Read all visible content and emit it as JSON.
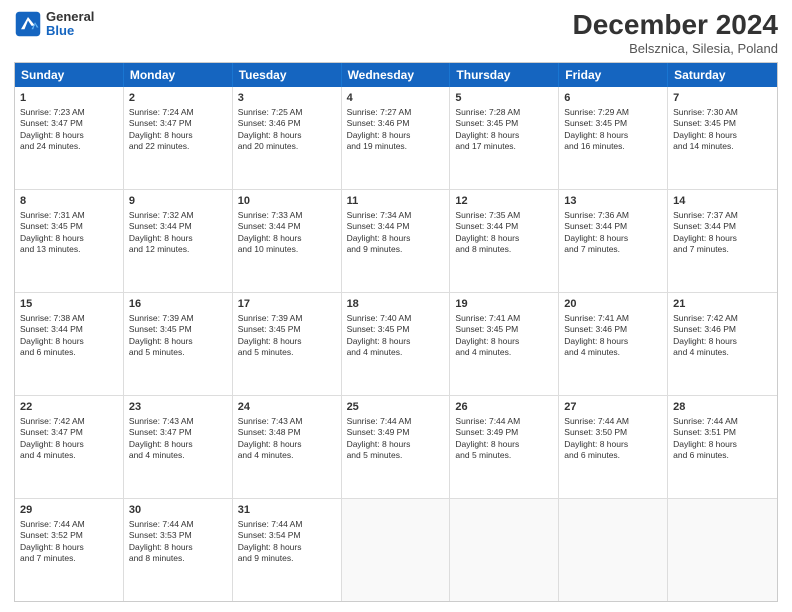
{
  "header": {
    "logo_line1": "General",
    "logo_line2": "Blue",
    "title": "December 2024",
    "subtitle": "Belsznica, Silesia, Poland"
  },
  "days_of_week": [
    "Sunday",
    "Monday",
    "Tuesday",
    "Wednesday",
    "Thursday",
    "Friday",
    "Saturday"
  ],
  "weeks": [
    [
      {
        "day": "1",
        "lines": [
          "Sunrise: 7:23 AM",
          "Sunset: 3:47 PM",
          "Daylight: 8 hours",
          "and 24 minutes."
        ]
      },
      {
        "day": "2",
        "lines": [
          "Sunrise: 7:24 AM",
          "Sunset: 3:47 PM",
          "Daylight: 8 hours",
          "and 22 minutes."
        ]
      },
      {
        "day": "3",
        "lines": [
          "Sunrise: 7:25 AM",
          "Sunset: 3:46 PM",
          "Daylight: 8 hours",
          "and 20 minutes."
        ]
      },
      {
        "day": "4",
        "lines": [
          "Sunrise: 7:27 AM",
          "Sunset: 3:46 PM",
          "Daylight: 8 hours",
          "and 19 minutes."
        ]
      },
      {
        "day": "5",
        "lines": [
          "Sunrise: 7:28 AM",
          "Sunset: 3:45 PM",
          "Daylight: 8 hours",
          "and 17 minutes."
        ]
      },
      {
        "day": "6",
        "lines": [
          "Sunrise: 7:29 AM",
          "Sunset: 3:45 PM",
          "Daylight: 8 hours",
          "and 16 minutes."
        ]
      },
      {
        "day": "7",
        "lines": [
          "Sunrise: 7:30 AM",
          "Sunset: 3:45 PM",
          "Daylight: 8 hours",
          "and 14 minutes."
        ]
      }
    ],
    [
      {
        "day": "8",
        "lines": [
          "Sunrise: 7:31 AM",
          "Sunset: 3:45 PM",
          "Daylight: 8 hours",
          "and 13 minutes."
        ]
      },
      {
        "day": "9",
        "lines": [
          "Sunrise: 7:32 AM",
          "Sunset: 3:44 PM",
          "Daylight: 8 hours",
          "and 12 minutes."
        ]
      },
      {
        "day": "10",
        "lines": [
          "Sunrise: 7:33 AM",
          "Sunset: 3:44 PM",
          "Daylight: 8 hours",
          "and 10 minutes."
        ]
      },
      {
        "day": "11",
        "lines": [
          "Sunrise: 7:34 AM",
          "Sunset: 3:44 PM",
          "Daylight: 8 hours",
          "and 9 minutes."
        ]
      },
      {
        "day": "12",
        "lines": [
          "Sunrise: 7:35 AM",
          "Sunset: 3:44 PM",
          "Daylight: 8 hours",
          "and 8 minutes."
        ]
      },
      {
        "day": "13",
        "lines": [
          "Sunrise: 7:36 AM",
          "Sunset: 3:44 PM",
          "Daylight: 8 hours",
          "and 7 minutes."
        ]
      },
      {
        "day": "14",
        "lines": [
          "Sunrise: 7:37 AM",
          "Sunset: 3:44 PM",
          "Daylight: 8 hours",
          "and 7 minutes."
        ]
      }
    ],
    [
      {
        "day": "15",
        "lines": [
          "Sunrise: 7:38 AM",
          "Sunset: 3:44 PM",
          "Daylight: 8 hours",
          "and 6 minutes."
        ]
      },
      {
        "day": "16",
        "lines": [
          "Sunrise: 7:39 AM",
          "Sunset: 3:45 PM",
          "Daylight: 8 hours",
          "and 5 minutes."
        ]
      },
      {
        "day": "17",
        "lines": [
          "Sunrise: 7:39 AM",
          "Sunset: 3:45 PM",
          "Daylight: 8 hours",
          "and 5 minutes."
        ]
      },
      {
        "day": "18",
        "lines": [
          "Sunrise: 7:40 AM",
          "Sunset: 3:45 PM",
          "Daylight: 8 hours",
          "and 4 minutes."
        ]
      },
      {
        "day": "19",
        "lines": [
          "Sunrise: 7:41 AM",
          "Sunset: 3:45 PM",
          "Daylight: 8 hours",
          "and 4 minutes."
        ]
      },
      {
        "day": "20",
        "lines": [
          "Sunrise: 7:41 AM",
          "Sunset: 3:46 PM",
          "Daylight: 8 hours",
          "and 4 minutes."
        ]
      },
      {
        "day": "21",
        "lines": [
          "Sunrise: 7:42 AM",
          "Sunset: 3:46 PM",
          "Daylight: 8 hours",
          "and 4 minutes."
        ]
      }
    ],
    [
      {
        "day": "22",
        "lines": [
          "Sunrise: 7:42 AM",
          "Sunset: 3:47 PM",
          "Daylight: 8 hours",
          "and 4 minutes."
        ]
      },
      {
        "day": "23",
        "lines": [
          "Sunrise: 7:43 AM",
          "Sunset: 3:47 PM",
          "Daylight: 8 hours",
          "and 4 minutes."
        ]
      },
      {
        "day": "24",
        "lines": [
          "Sunrise: 7:43 AM",
          "Sunset: 3:48 PM",
          "Daylight: 8 hours",
          "and 4 minutes."
        ]
      },
      {
        "day": "25",
        "lines": [
          "Sunrise: 7:44 AM",
          "Sunset: 3:49 PM",
          "Daylight: 8 hours",
          "and 5 minutes."
        ]
      },
      {
        "day": "26",
        "lines": [
          "Sunrise: 7:44 AM",
          "Sunset: 3:49 PM",
          "Daylight: 8 hours",
          "and 5 minutes."
        ]
      },
      {
        "day": "27",
        "lines": [
          "Sunrise: 7:44 AM",
          "Sunset: 3:50 PM",
          "Daylight: 8 hours",
          "and 6 minutes."
        ]
      },
      {
        "day": "28",
        "lines": [
          "Sunrise: 7:44 AM",
          "Sunset: 3:51 PM",
          "Daylight: 8 hours",
          "and 6 minutes."
        ]
      }
    ],
    [
      {
        "day": "29",
        "lines": [
          "Sunrise: 7:44 AM",
          "Sunset: 3:52 PM",
          "Daylight: 8 hours",
          "and 7 minutes."
        ]
      },
      {
        "day": "30",
        "lines": [
          "Sunrise: 7:44 AM",
          "Sunset: 3:53 PM",
          "Daylight: 8 hours",
          "and 8 minutes."
        ]
      },
      {
        "day": "31",
        "lines": [
          "Sunrise: 7:44 AM",
          "Sunset: 3:54 PM",
          "Daylight: 8 hours",
          "and 9 minutes."
        ]
      },
      null,
      null,
      null,
      null
    ]
  ]
}
